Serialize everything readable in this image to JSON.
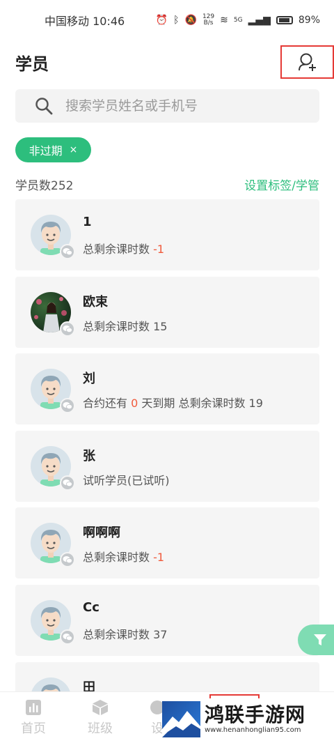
{
  "status_bar": {
    "carrier_time": "中国移动 10:46",
    "net_speed_value": "129",
    "net_speed_unit": "B/s",
    "signal_label": "5G",
    "battery": "89%"
  },
  "header": {
    "title": "学员",
    "add_student_icon": "add-person-icon"
  },
  "search": {
    "placeholder": "搜索学员姓名或手机号"
  },
  "filter_chip": {
    "label": "非过期",
    "close": "×"
  },
  "summary": {
    "count_text": "学员数252",
    "settings_link": "设置标签/学管"
  },
  "students": [
    {
      "name": "1",
      "info_prefix": "总剩余课时数 ",
      "info_highlight": "-1",
      "info_suffix": "",
      "avatar": "default"
    },
    {
      "name": "欧束",
      "info_prefix": "总剩余课时数 15",
      "info_highlight": "",
      "info_suffix": "",
      "avatar": "photo"
    },
    {
      "name": "刘",
      "info_prefix": "合约还有 ",
      "info_highlight": "0",
      "info_suffix": " 天到期 总剩余课时数 19",
      "avatar": "default"
    },
    {
      "name": "张",
      "info_prefix": "试听学员(已试听)",
      "info_highlight": "",
      "info_suffix": "",
      "avatar": "default"
    },
    {
      "name": "啊啊啊",
      "info_prefix": "总剩余课时数 ",
      "info_highlight": "-1",
      "info_suffix": "",
      "avatar": "default"
    },
    {
      "name": "Cc",
      "info_prefix": "总剩余课时数 37",
      "info_highlight": "",
      "info_suffix": "",
      "avatar": "default"
    },
    {
      "name": "田",
      "info_prefix": "",
      "info_highlight": "",
      "info_suffix": "",
      "avatar": "default"
    }
  ],
  "tabs": [
    {
      "label": "首页",
      "icon": "chart-icon"
    },
    {
      "label": "班级",
      "icon": "cube-icon"
    },
    {
      "label": "设",
      "icon": "settings-icon"
    }
  ],
  "watermark": {
    "title": "鸿联手游网",
    "url": "www.henanhonglian95.com"
  },
  "colors": {
    "accent": "#2dbe7d",
    "highlight": "#f05a3c",
    "annotation": "#e53935"
  }
}
